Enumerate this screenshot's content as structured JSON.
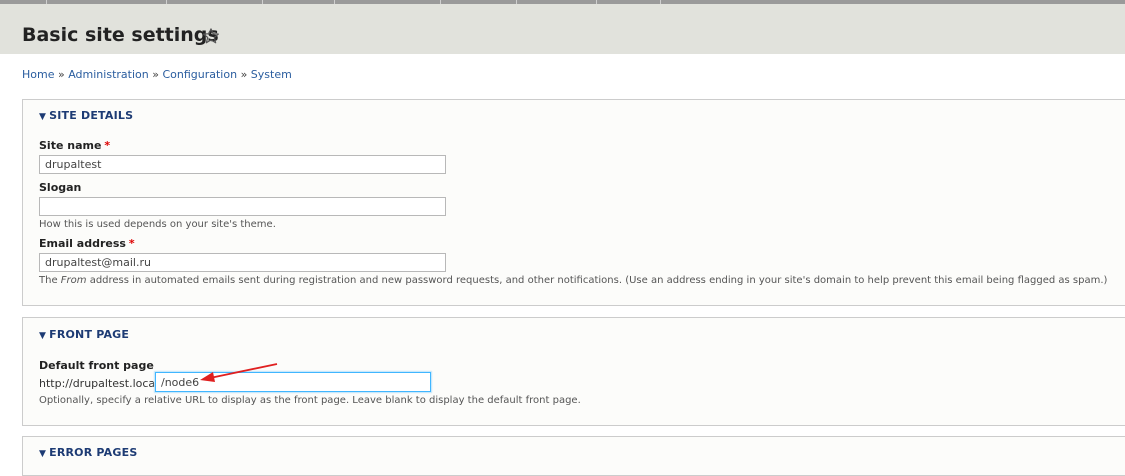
{
  "page": {
    "title": "Basic site settings"
  },
  "breadcrumb": {
    "items": [
      "Home",
      "Administration",
      "Configuration",
      "System"
    ],
    "separator": "»"
  },
  "site_details": {
    "legend": "SITE DETAILS",
    "site_name": {
      "label": "Site name",
      "value": "drupaltest",
      "required_marker": "*"
    },
    "slogan": {
      "label": "Slogan",
      "value": "",
      "description": "How this is used depends on your site's theme."
    },
    "email": {
      "label": "Email address",
      "value": "drupaltest@mail.ru",
      "required_marker": "*",
      "description_pre": "The ",
      "description_em": "From",
      "description_post": " address in automated emails sent during registration and new password requests, and other notifications. (Use an address ending in your site's domain to help prevent this email being flagged as spam.)"
    }
  },
  "front_page": {
    "legend": "FRONT PAGE",
    "default_front_page": {
      "label": "Default front page",
      "prefix": "http://drupaltest.local",
      "value": "/node6",
      "description": "Optionally, specify a relative URL to display as the front page. Leave blank to display the default front page."
    }
  },
  "error_pages": {
    "legend": "ERROR PAGES"
  },
  "colors": {
    "header_bg": "#e1e2dc",
    "link": "#2a5d9f",
    "legend": "#1d3b74",
    "required": "#dd0000",
    "annotation_arrow": "#e02020",
    "focus_border": "#40b6ff"
  }
}
